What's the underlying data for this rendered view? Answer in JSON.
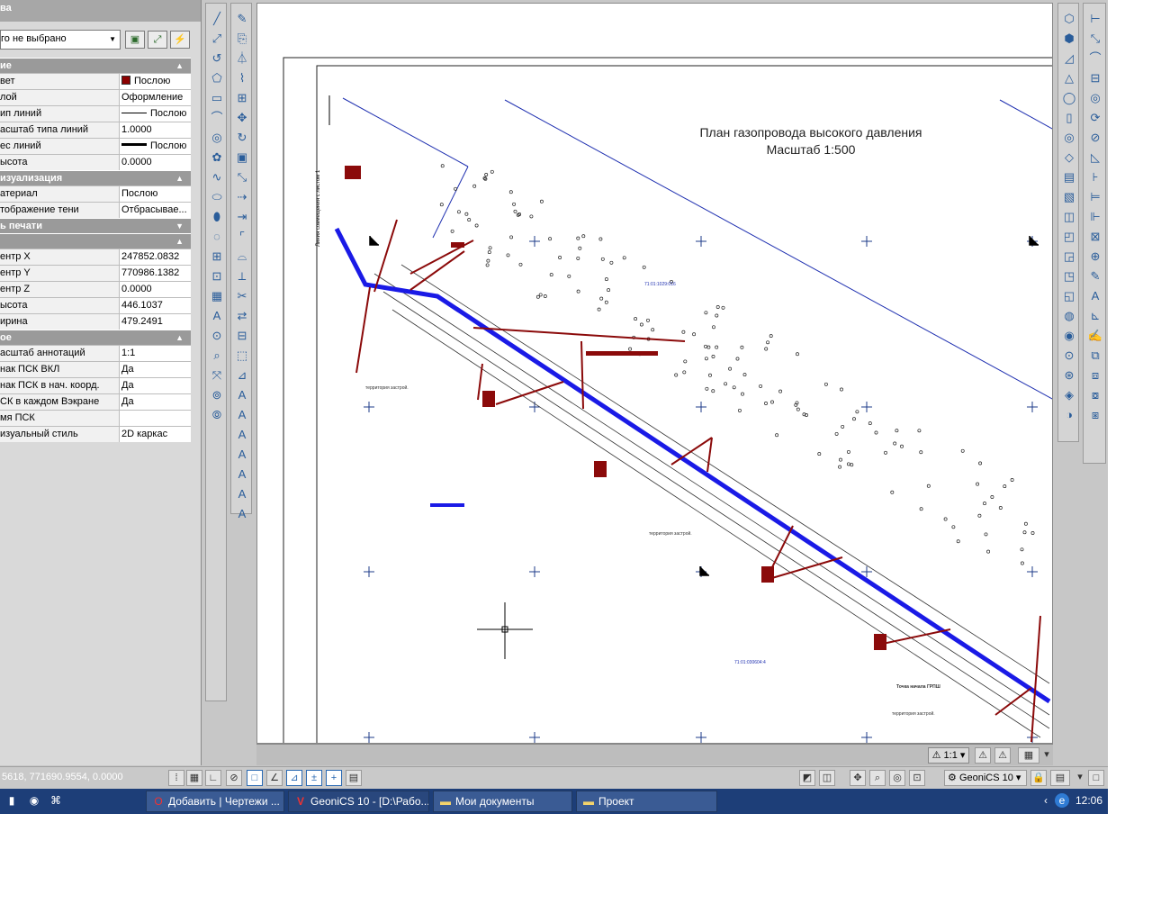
{
  "props": {
    "title": "ва",
    "selection": "го не выбрано",
    "sections": [
      {
        "name": "ие",
        "rows": [
          {
            "k": "вет",
            "v": "Послою",
            "kind": "color"
          },
          {
            "k": "лой",
            "v": "Оформление"
          },
          {
            "k": "ип линий",
            "v": "Послою",
            "kind": "line"
          },
          {
            "k": "асштаб типа линий",
            "v": "1.0000"
          },
          {
            "k": "ес линий",
            "v": "Послою",
            "kind": "thick"
          },
          {
            "k": "ысота",
            "v": "0.0000"
          }
        ]
      },
      {
        "name": "изуализация",
        "rows": [
          {
            "k": "атериал",
            "v": "Послою"
          },
          {
            "k": "тображение тени",
            "v": "Отбрасывае..."
          }
        ]
      },
      {
        "name": "ь печати",
        "rows": []
      },
      {
        "name": "",
        "rows": [
          {
            "k": "ентр X",
            "v": "247852.0832"
          },
          {
            "k": "ентр Y",
            "v": "770986.1382"
          },
          {
            "k": "ентр Z",
            "v": "0.0000"
          },
          {
            "k": "ысота",
            "v": "446.1037"
          },
          {
            "k": "ирина",
            "v": "479.2491"
          }
        ]
      },
      {
        "name": "ое",
        "rows": [
          {
            "k": "асштаб аннотаций",
            "v": "1:1"
          },
          {
            "k": "нак ПСК ВКЛ",
            "v": "Да"
          },
          {
            "k": "нак ПСК в нач. коорд.",
            "v": "Да"
          },
          {
            "k": "СК в каждом Вэкране",
            "v": "Да"
          },
          {
            "k": "мя ПСК",
            "v": ""
          },
          {
            "k": "изуальный стиль",
            "v": "2D каркас"
          }
        ]
      }
    ]
  },
  "drawing": {
    "title_line1": "План газопровода высокого давления",
    "title_line2": "Масштаб 1:500"
  },
  "layoutbar": {
    "scale": "1:1"
  },
  "status": {
    "coords": "5618, 771690.9554, 0.0000",
    "workspace": "GeoniCS 10"
  },
  "taskbar": {
    "tasks": [
      {
        "label": "Добавить | Чертежи ...",
        "icon": "opera-icon"
      },
      {
        "label": "GeoniCS 10 - [D:\\Рабо...",
        "icon": "geonics-icon"
      },
      {
        "label": "Мои документы",
        "icon": "folder-icon"
      },
      {
        "label": "Проект",
        "icon": "folder-icon"
      }
    ],
    "clock": "12:06"
  }
}
